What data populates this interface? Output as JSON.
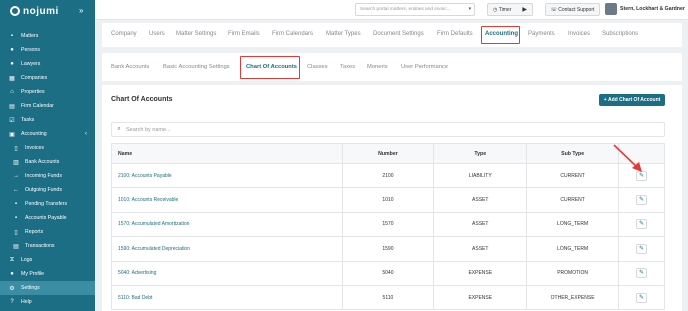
{
  "brand": {
    "logo_text": "nojumi"
  },
  "sidebar": {
    "items": [
      {
        "label": "Matters",
        "icon": "briefcase-icon"
      },
      {
        "label": "Persons",
        "icon": "people-icon"
      },
      {
        "label": "Lawyers",
        "icon": "person-icon"
      },
      {
        "label": "Companies",
        "icon": "building-icon"
      },
      {
        "label": "Properties",
        "icon": "home-icon"
      },
      {
        "label": "Firm Calendar",
        "icon": "calendar-icon"
      },
      {
        "label": "Tasks",
        "icon": "tasks-icon"
      },
      {
        "label": "Accounting",
        "icon": "calculator-icon"
      },
      {
        "label": "Invoices",
        "icon": "invoice-icon"
      },
      {
        "label": "Bank Accounts",
        "icon": "bank-icon"
      },
      {
        "label": "Incoming Funds",
        "icon": "arrow-right-icon"
      },
      {
        "label": "Outgoing Funds",
        "icon": "arrow-left-icon"
      },
      {
        "label": "Pending Transfers",
        "icon": "pending-icon"
      },
      {
        "label": "Accounts Payable",
        "icon": "payable-icon"
      },
      {
        "label": "Reports",
        "icon": "reports-icon"
      },
      {
        "label": "Transactions",
        "icon": "transactions-icon"
      },
      {
        "label": "Logs",
        "icon": "logs-icon"
      },
      {
        "label": "My Profile",
        "icon": "profile-icon"
      },
      {
        "label": "Settings",
        "icon": "gear-icon"
      },
      {
        "label": "Help",
        "icon": "help-icon"
      }
    ]
  },
  "topbar": {
    "search_placeholder": "Search portal matters, entities and invoic...",
    "timer_label": "Timer",
    "support_label": "Contact Support",
    "user_name": "Stern, Lockhart & Gardner"
  },
  "settings_tabs": [
    "Company",
    "Users",
    "Matter Settings",
    "Firm Emails",
    "Firm Calendars",
    "Matter Types",
    "Document Settings",
    "Firm Defaults",
    "Accounting",
    "Payments",
    "Invoices",
    "Subscriptions"
  ],
  "accounting_tabs": [
    "Bank Accounts",
    "Basic Accounting Settings",
    "Chart Of Accounts",
    "Classes",
    "Taxes",
    "Moneris",
    "User Performance"
  ],
  "page": {
    "title": "Chart Of Accounts",
    "add_button": "Add Chart Of Account",
    "search_placeholder": "Search by name..."
  },
  "table": {
    "headers": [
      "Name",
      "Number",
      "Type",
      "Sub Type"
    ],
    "rows": [
      {
        "name": "2100: Accounts Payable",
        "number": "2100",
        "type": "LIABILITY",
        "subtype": "CURRENT"
      },
      {
        "name": "1010: Accounts Receivable",
        "number": "1010",
        "type": "ASSET",
        "subtype": "CURRENT"
      },
      {
        "name": "1570: Accumulated Amortization",
        "number": "1570",
        "type": "ASSET",
        "subtype": "LONG_TERM"
      },
      {
        "name": "1590: Accumulated Depreciation",
        "number": "1590",
        "type": "ASSET",
        "subtype": "LONG_TERM"
      },
      {
        "name": "5040: Advertising",
        "number": "5040",
        "type": "EXPENSE",
        "subtype": "PROMOTION"
      },
      {
        "name": "5110: Bad Debt",
        "number": "5110",
        "type": "EXPENSE",
        "subtype": "OTHER_EXPENSE"
      }
    ]
  },
  "colors": {
    "accent": "#1c6e84",
    "highlight": "#e53935",
    "sidebar_bg": "#1c6e84"
  }
}
